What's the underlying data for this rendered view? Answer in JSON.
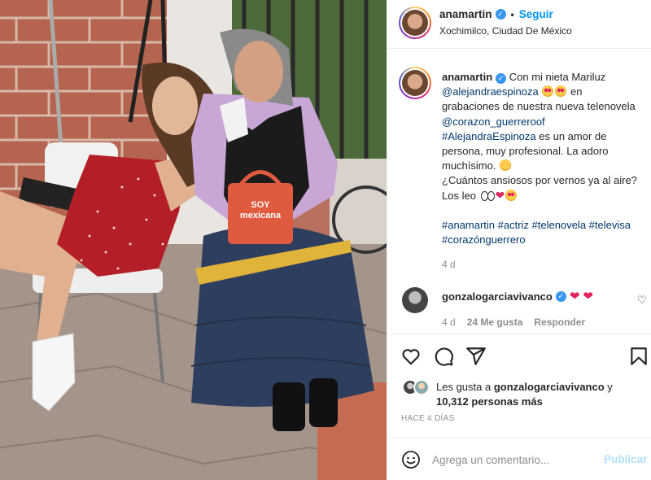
{
  "post": {
    "username": "anamartin",
    "follow_label": "Seguir",
    "separator": "•",
    "location": "Xochimilco, Ciudad De México"
  },
  "caption": {
    "username": "anamartin",
    "line1_text": "Con mi nieta Mariluz",
    "mention1": "@alejandraespinoza",
    "line2_text": "en",
    "line3_text": "grabaciones de nuestra nueva telenovela",
    "mention2": "@corazon_guerreroof",
    "hashtag_name": "#AlejandraEspinoza",
    "line5_text": "es un amor de",
    "line6_text": "persona, muy profesional. La adoro",
    "line7_text": "muchísimo.",
    "line8_text": "¿Cuántos ansiosos por vernos ya al aire?",
    "line9_text": "Los leo",
    "hashtags_line1": "#anamartin #actriz #telenovela #televisa",
    "hashtags_line2": "#corazónguerrero",
    "time": "4 d"
  },
  "comment": {
    "username": "gonzalogarciavivanco",
    "time": "4 d",
    "likes": "24 Me gusta",
    "reply_label": "Responder"
  },
  "likes": {
    "prefix": "Les gusta a",
    "user": "gonzalogarciavivanco",
    "conjunction": "y",
    "count": "10,312 personas más"
  },
  "timestamp": "HACE 4 DÍAS",
  "add_comment": {
    "placeholder": "Agrega un comentario...",
    "publish_label": "Publicar"
  },
  "photo": {
    "bag_text_line1": "SOY",
    "bag_text_line2": "mexicana"
  },
  "colors": {
    "link": "#00376b",
    "follow": "#0095f6",
    "verified": "#3897f0",
    "heart": "#e0245e",
    "publish_disabled": "#b2dffc",
    "muted": "#8e8e8e"
  },
  "icons": [
    "verified-badge-icon",
    "heart-icon",
    "comment-icon",
    "share-icon",
    "bookmark-icon",
    "emoji-icon"
  ]
}
